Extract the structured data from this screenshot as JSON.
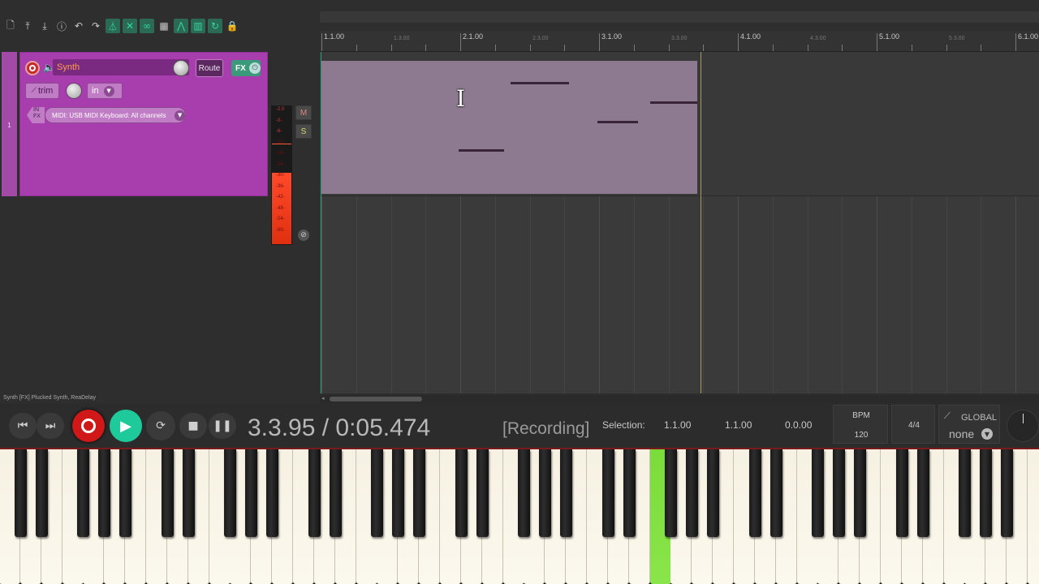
{
  "toolbar": {
    "icons": [
      "new-file-icon",
      "open-icon",
      "save-icon",
      "info-icon",
      "undo-icon",
      "redo-icon",
      "metronome-icon",
      "ripple-icon",
      "link-icon",
      "grid-icon",
      "snap-icon",
      "grid-lines-icon",
      "loop-icon",
      "lock-icon"
    ]
  },
  "track": {
    "number": "1",
    "name": "Synth",
    "route_label": "Route",
    "fx_label": "FX",
    "trim_label": "trim",
    "input_label": "in",
    "input_fx_label": "IN FX",
    "midi_input": "MIDI: USB MIDI Keyboard: All channels",
    "mute_label": "M",
    "solo_label": "S",
    "meter_ticks": [
      "-2.0",
      "-0-",
      "-6-",
      "-12-",
      "-18-",
      "-24-",
      "-30-",
      "-36-",
      "-42-",
      "-48-",
      "-54-",
      "-60-"
    ],
    "meter_level": 0.52
  },
  "ruler": {
    "major": [
      "1.1.00",
      "2.1.00",
      "3.1.00",
      "4.1.00",
      "5.1.00",
      "6.1.00"
    ],
    "minor": [
      "1.3.00",
      "2.3.00",
      "3.3.00",
      "4.3.00",
      "5.3.00"
    ]
  },
  "status": {
    "fx_chain": "Synth [FX] Plucked Synth, ReaDelay"
  },
  "transport": {
    "time": "3.3.95 / 0:05.474",
    "status": "[Recording]",
    "selection_label": "Selection:",
    "selection_start": "1.1.00",
    "selection_end": "1.1.00",
    "selection_length": "0.0.00",
    "bpm_label": "BPM",
    "bpm_value": "120",
    "time_signature": "4/4",
    "global_label": "GLOBAL",
    "global_value": "none"
  },
  "keyboard": {
    "active_key": "white-key-31"
  },
  "colors": {
    "track": "#a83eae",
    "midi_item": "#8d7a90",
    "record": "#d01818",
    "play": "#1ec99a",
    "active_key": "#7adc3a"
  }
}
